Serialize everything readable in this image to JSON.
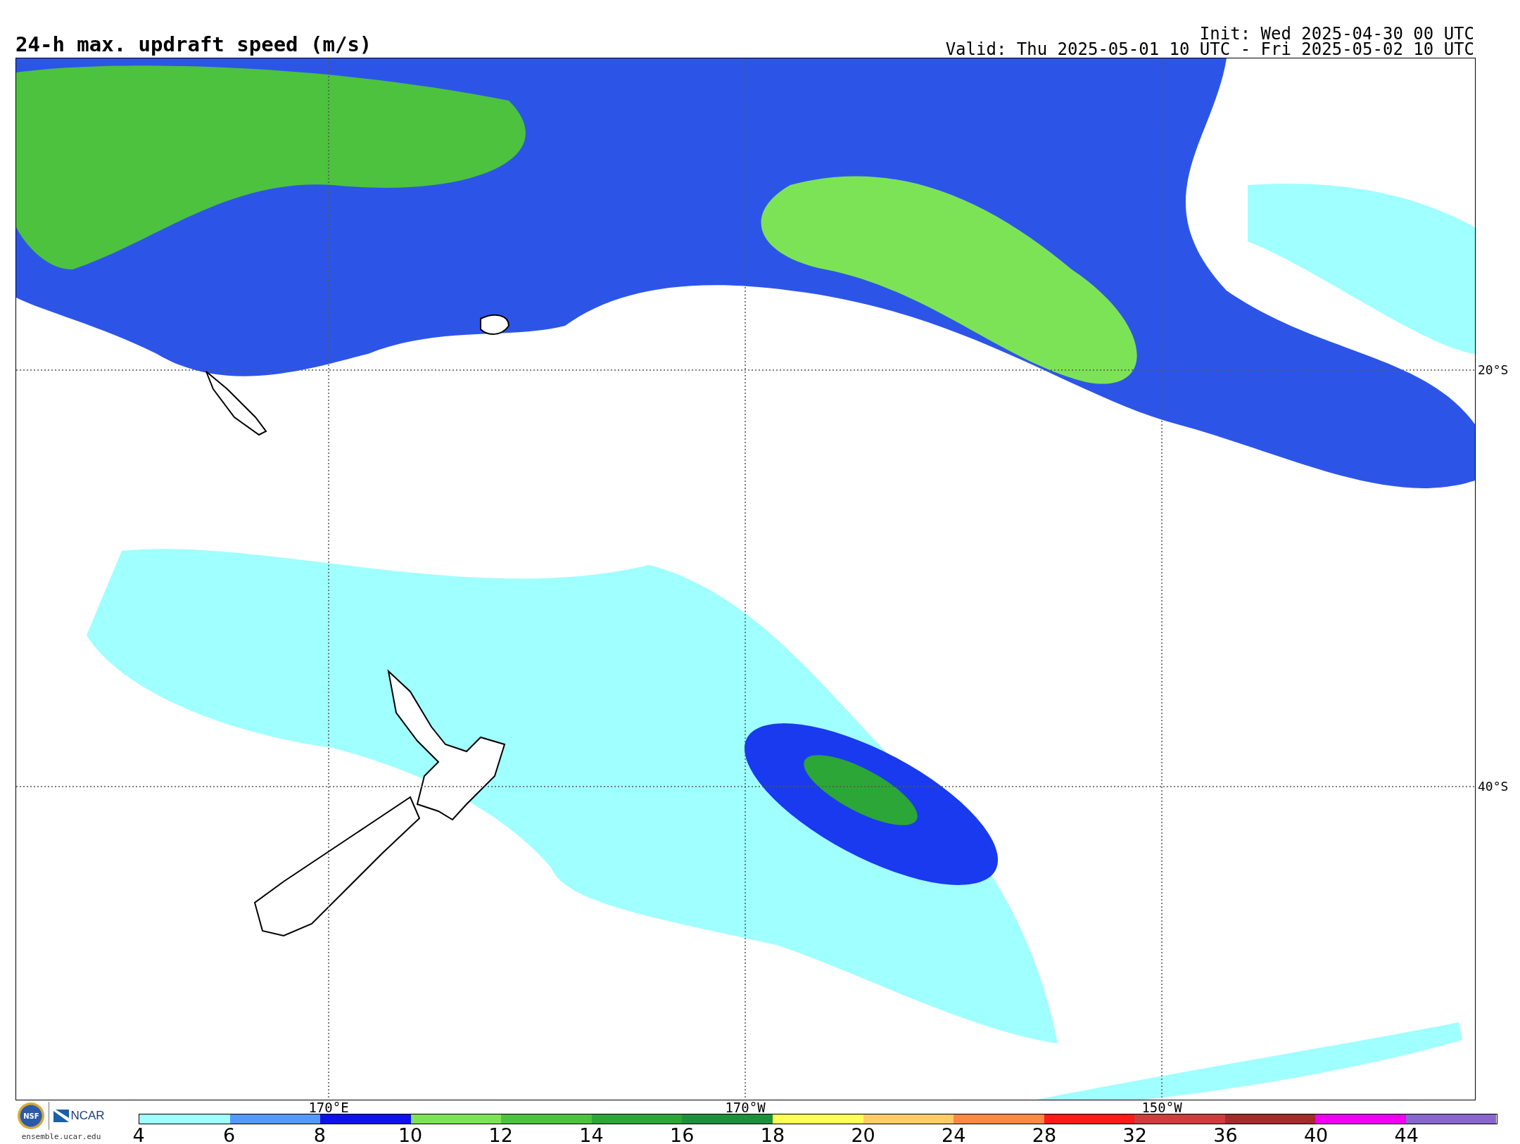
{
  "title": "24-h max. updraft speed (m/s)",
  "init": "Init: Wed 2025-04-30 00 UTC",
  "valid": "Valid: Thu 2025-05-01 10 UTC - Fri 2025-05-02 10 UTC",
  "latitude_labels": [
    "20°S",
    "40°S"
  ],
  "longitude_labels": [
    "170°E",
    "170°W",
    "150°W"
  ],
  "logos": {
    "nsf": "NSF",
    "ncar": "NCAR",
    "website": "ensemble.ucar.edu"
  },
  "colorbar": {
    "bins": [
      {
        "color": "#a0ffff"
      },
      {
        "color": "#5599ff"
      },
      {
        "color": "#1010ee"
      },
      {
        "color": "#7de356"
      },
      {
        "color": "#4cc23f"
      },
      {
        "color": "#2ca636"
      },
      {
        "color": "#1e8f3c"
      },
      {
        "color": "#ffff55"
      },
      {
        "color": "#ffcc66"
      },
      {
        "color": "#ff8844"
      },
      {
        "color": "#ff1a1a"
      },
      {
        "color": "#cc3d3d"
      },
      {
        "color": "#a02c2c"
      },
      {
        "color": "#ee00ee"
      },
      {
        "color": "#8866cc"
      }
    ],
    "tick_labels": [
      "4",
      "6",
      "8",
      "10",
      "12",
      "14",
      "16",
      "18",
      "20",
      "24",
      "28",
      "32",
      "36",
      "40",
      "44"
    ]
  }
}
